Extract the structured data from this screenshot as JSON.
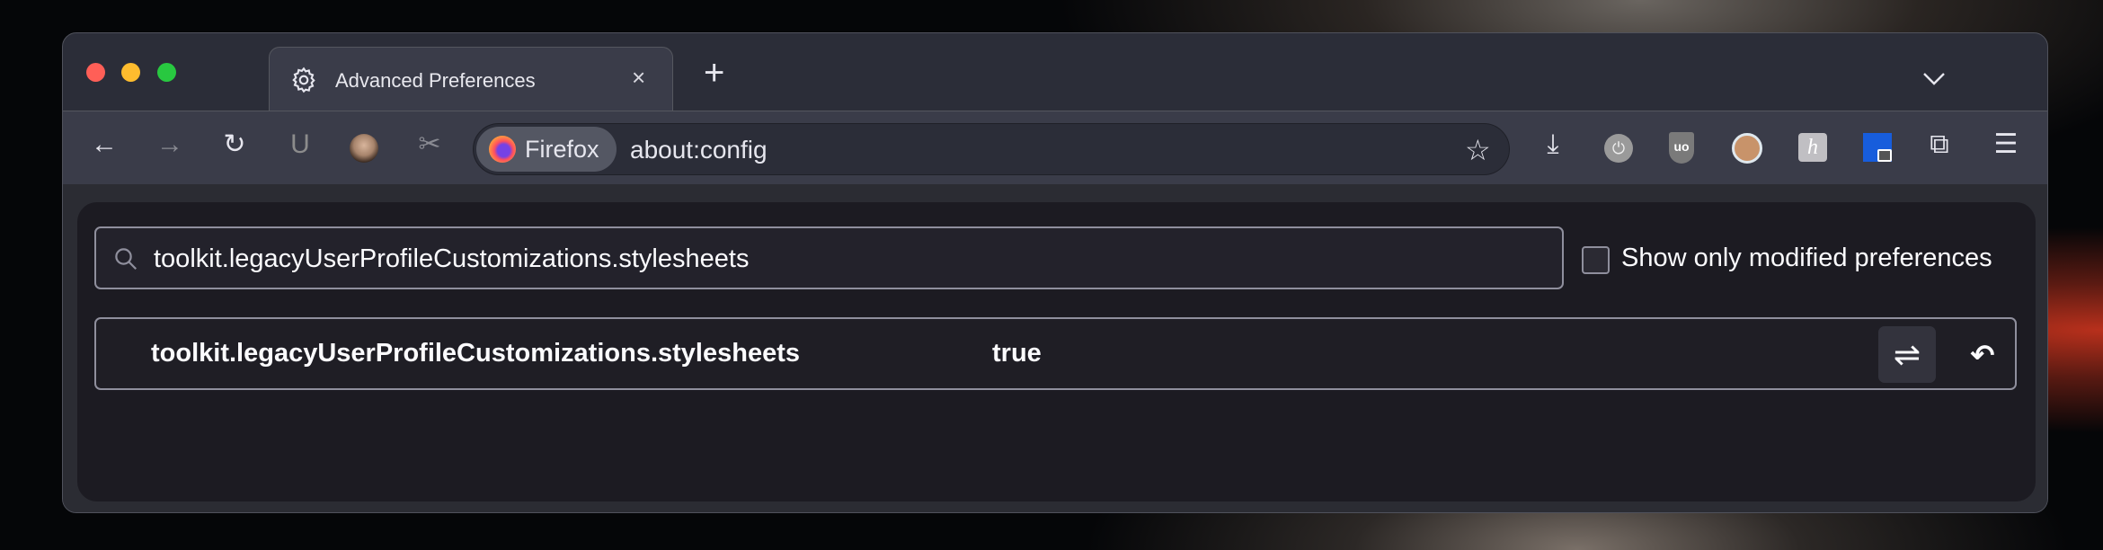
{
  "window": {
    "traffic_lights": {
      "close": "#ff5f57",
      "minimize": "#febc2e",
      "maximize": "#28c840"
    }
  },
  "tabs": [
    {
      "title": "Advanced Preferences",
      "icon": "gear-icon",
      "active": true
    }
  ],
  "tabstrip": {
    "new_tab": "+",
    "list_all_tabs": "chevron-down-icon"
  },
  "toolbar": {
    "identity_label": "Firefox",
    "url": "about:config",
    "icons": [
      "back-icon",
      "forward-icon",
      "reload-icon",
      "magnet-extension-icon",
      "avatar-extension-icon",
      "screenshot-icon",
      "bookmark-star-icon",
      "downloads-icon",
      "power-extension-icon",
      "ublock-origin-icon",
      "glasses-extension-icon",
      "h-extension-icon",
      "bitwarden-lock-icon",
      "extensions-puzzle-icon",
      "menu-icon"
    ]
  },
  "config": {
    "search_value": "toolkit.legacyUserProfileCustomizations.stylesheets",
    "show_modified_label": "Show only modified preferences",
    "show_modified_checked": false,
    "prefs": [
      {
        "name": "toolkit.legacyUserProfileCustomizations.stylesheets",
        "value": "true"
      }
    ]
  }
}
